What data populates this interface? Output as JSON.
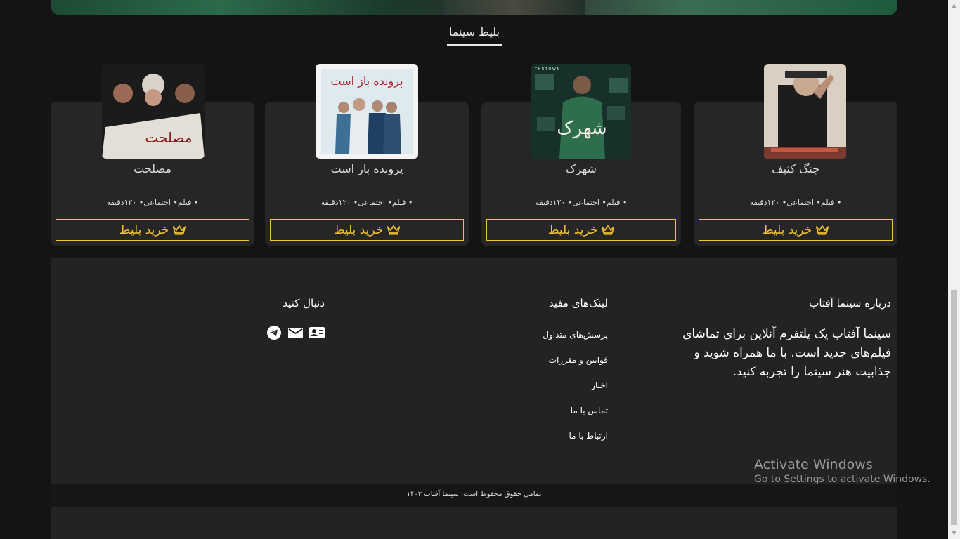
{
  "section": {
    "title": "بلیط سینما"
  },
  "movies": [
    {
      "title": "جنگ کثیف",
      "meta": "• فیلم• اجتماعی• ۱۲۰دقیقه",
      "buy_label": "خرید بلیط"
    },
    {
      "title": "شهرک",
      "meta": "• فیلم• اجتماعی• ۱۲۰دقیقه",
      "buy_label": "خرید بلیط"
    },
    {
      "title": "پرونده باز است",
      "meta": "• فیلم• اجتماعی• ۱۲۰دقیقه",
      "buy_label": "خرید بلیط"
    },
    {
      "title": "مصلحت",
      "meta": "• فیلم• اجتماعی• ۱۲۰دقیقه",
      "buy_label": "خرید بلیط"
    }
  ],
  "posters": {
    "p1_text": "مصلحت",
    "p2_text": "پرونده باز است",
    "p3_text": "شهرک",
    "p3_top": "T H E   T O W N"
  },
  "footer": {
    "about_title": "درباره سینما آفتاب",
    "about_text": "سینما آفتاب یک پلتفرم آنلاین برای تماشای فیلم‌های جدید است. با ما همراه شوید و جذابیت هنر سینما را تجربه کنید.",
    "links_title": "لینک‌های مفید",
    "links": [
      "پرسش‌های متداول",
      "قوانین و مقررات",
      "اخبار",
      "تماس با ما",
      "ارتباط با ما"
    ],
    "follow_title": "دنبال کنید",
    "social_icons": [
      "contact-card-icon",
      "mail-icon",
      "telegram-icon"
    ],
    "copyright": "تمامی حقوق محفوظ است. سینما آفتاب ۱۴۰۲"
  },
  "watermark": {
    "line1": "Activate Windows",
    "line2": "Go to Settings to activate Windows."
  },
  "colors": {
    "accent": "#f2c230",
    "card": "#262626",
    "background": "#141414",
    "footer": "#232323"
  }
}
